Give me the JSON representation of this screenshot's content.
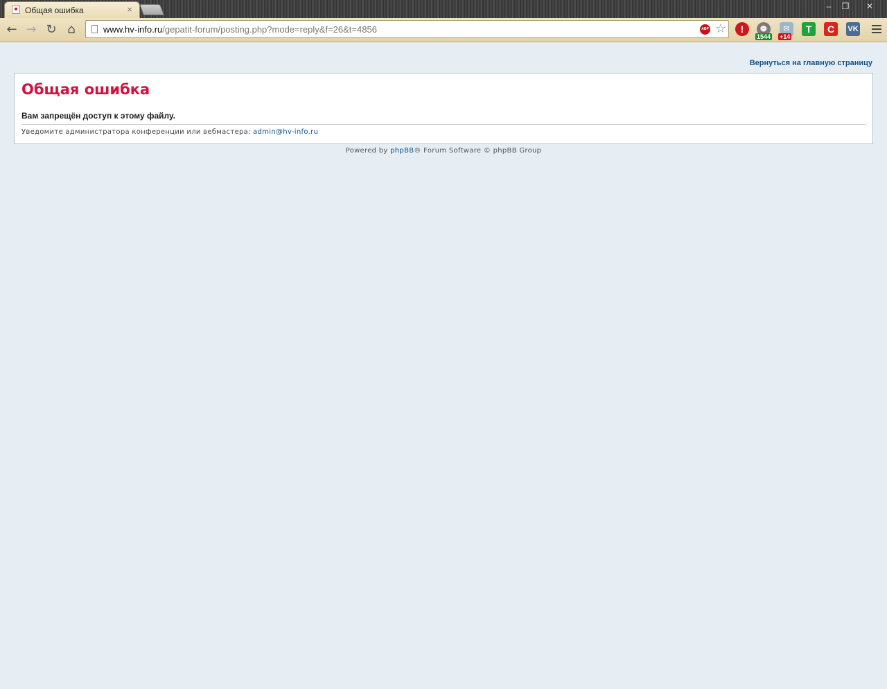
{
  "browser": {
    "tab": {
      "title": "Общая ошибка",
      "close": "×"
    },
    "window_controls": {
      "minimize": "–",
      "restore": "❐",
      "close": "✕"
    },
    "nav": {
      "back": "←",
      "forward": "→",
      "reload": "↻",
      "home": "⌂"
    },
    "address": {
      "host": "www.hv-info.ru",
      "path": "/gepatit-forum/posting.php?mode=reply&f=26&t=4856"
    },
    "adblock_label": "ABP",
    "extensions": [
      {
        "name": "alert-extension",
        "label": "!",
        "color": "#d4141b"
      },
      {
        "name": "counter-extension",
        "label": "⌚",
        "badge": "1544",
        "color": "#7a7a7a",
        "badge_color": "#1f8a2a"
      },
      {
        "name": "mail-extension",
        "label": "✉",
        "badge": "+14",
        "color": "#9fb6c8",
        "badge_color": "#c8141b"
      },
      {
        "name": "t-extension",
        "label": "T",
        "color": "#1fa33a"
      },
      {
        "name": "c-extension",
        "label": "C",
        "color": "#d8261e"
      },
      {
        "name": "vk-extension",
        "label": "VK",
        "color": "#4a6c96"
      }
    ]
  },
  "page": {
    "back_link": "Вернуться на главную страницу",
    "error": {
      "title": "Общая ошибка",
      "message": "Вам запрещён доступ к этому файлу.",
      "notice_prefix": "Уведомите администратора конференции или вебмастера:",
      "admin_email": "admin@hv-info.ru"
    },
    "footer": {
      "prefix": "Powered by",
      "brand": "phpBB",
      "suffix": "® Forum Software © phpBB Group"
    }
  },
  "colors": {
    "page_bg": "#e6eef4",
    "error_title": "#d31141",
    "link": "#105289"
  }
}
